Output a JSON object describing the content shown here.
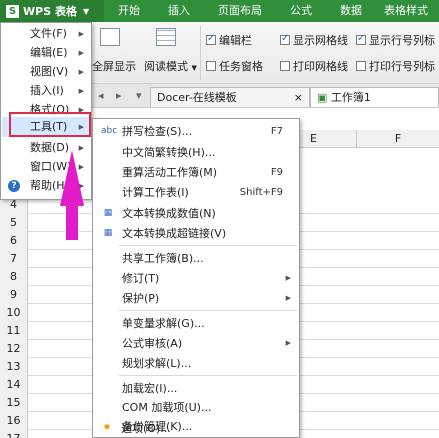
{
  "titlebar": {
    "app_name": "WPS 表格",
    "tabs": [
      "开始",
      "插入",
      "页面布局",
      "公式",
      "数据",
      "表格样式"
    ]
  },
  "ribbon": {
    "fullscreen_label": "全屏显示",
    "reading_mode_label": "阅读模式",
    "checkboxes": [
      {
        "label": "编辑栏",
        "checked": true
      },
      {
        "label": "显示网格线",
        "checked": true
      },
      {
        "label": "显示行号列标",
        "checked": true
      },
      {
        "label": "任务窗格",
        "checked": false
      },
      {
        "label": "打印网格线",
        "checked": false
      },
      {
        "label": "打印行号列标",
        "checked": false
      }
    ]
  },
  "tabbar": {
    "docer_tab": "Docer-在线模板",
    "workbook_tab": "工作簿1"
  },
  "sheet": {
    "columns": [
      "E",
      "F"
    ],
    "rows": [
      "4",
      "5",
      "6",
      "7",
      "8",
      "9",
      "10",
      "11",
      "12",
      "13",
      "14",
      "15",
      "16",
      "17"
    ]
  },
  "main_menu": {
    "items": [
      {
        "label": "文件(F)",
        "arrow": true
      },
      {
        "label": "编辑(E)",
        "arrow": true
      },
      {
        "label": "视图(V)",
        "arrow": true
      },
      {
        "label": "插入(I)",
        "arrow": true
      },
      {
        "label": "格式(O)",
        "arrow": true
      },
      {
        "label": "工具(T)",
        "arrow": true
      },
      {
        "label": "数据(D)",
        "arrow": true
      },
      {
        "label": "窗口(W)",
        "arrow": true
      },
      {
        "label": "帮助(H)",
        "arrow": true
      }
    ]
  },
  "sub_menu": {
    "items": [
      {
        "label": "拼写检查(S)...",
        "shortcut": "F7",
        "icon": "spellcheck-icon",
        "glyph": "abc"
      },
      {
        "label": "中文简繁转换(H)...",
        "shortcut": "",
        "icon": "",
        "glyph": ""
      },
      {
        "label": "重算活动工作簿(M)",
        "shortcut": "F9",
        "icon": "",
        "glyph": ""
      },
      {
        "label": "计算工作表(I)",
        "shortcut": "Shift+F9",
        "icon": "",
        "glyph": ""
      },
      {
        "label": "文本转换成数值(N)",
        "shortcut": "",
        "icon": "convert-number-icon",
        "glyph": "▦"
      },
      {
        "label": "文本转换成超链接(V)",
        "shortcut": "",
        "icon": "convert-link-icon",
        "glyph": "▦"
      },
      {
        "label": "共享工作簿(B)...",
        "shortcut": "",
        "icon": "",
        "glyph": ""
      },
      {
        "label": "修订(T)",
        "shortcut": "",
        "icon": "",
        "glyph": "",
        "arrow": true
      },
      {
        "label": "保护(P)",
        "shortcut": "",
        "icon": "",
        "glyph": "",
        "arrow": true
      },
      {
        "label": "单变量求解(G)...",
        "shortcut": "",
        "icon": "",
        "glyph": ""
      },
      {
        "label": "公式审核(A)",
        "shortcut": "",
        "icon": "",
        "glyph": "",
        "arrow": true
      },
      {
        "label": "规划求解(L)...",
        "shortcut": "",
        "icon": "",
        "glyph": ""
      },
      {
        "label": "加载宏(I)...",
        "shortcut": "",
        "icon": "",
        "glyph": ""
      },
      {
        "label": "COM 加载项(U)...",
        "shortcut": "",
        "icon": "",
        "glyph": ""
      },
      {
        "label": "备份管理(K)...",
        "shortcut": "",
        "icon": "",
        "glyph": ""
      },
      {
        "label": "选项(O)...",
        "shortcut": "",
        "icon": "options-gear-icon",
        "glyph": "✹"
      }
    ]
  },
  "colors": {
    "titlebar": "#2f8f3a",
    "highlight_box": "#e02a4a",
    "pointer_arrow": "#e21cc8"
  }
}
